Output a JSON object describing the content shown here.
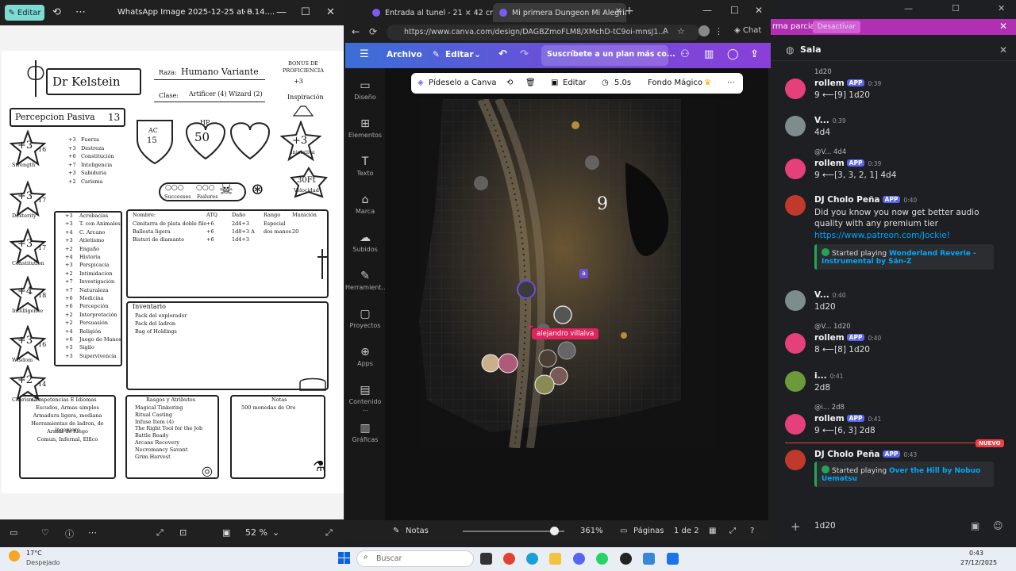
{
  "photos": {
    "edit_label": "Editar",
    "title": "WhatsApp Image 2025-12-25 at 8.14....",
    "zoom": "52 %"
  },
  "sheet": {
    "name": "Dr Kelstein",
    "raza_label": "Raza:",
    "raza": "Humano Variante",
    "clase_label": "Clase:",
    "clase": "Artificer (4) Wizard (2)",
    "bonus_label": "BONUS DE PROFICIENCIA",
    "bonus": "+3",
    "inspiracion": "Inspiración",
    "percepcion_label": "Percepcion Pasiva",
    "percepcion": "13",
    "ac_label": "AC",
    "ac": "15",
    "hp_label": "HP",
    "hp": "50",
    "iniciativa": "+3",
    "iniciativa_label": "Iniciativa",
    "velocidad": "30Ft",
    "velocidad_label": "Velocidad",
    "successes": "Successes",
    "failures": "Failures",
    "abilities": [
      {
        "mod": "+3",
        "score": "16",
        "label": "Strength"
      },
      {
        "mod": "+3",
        "score": "17",
        "label": "Dexterity"
      },
      {
        "mod": "+3",
        "score": "17",
        "label": "Constitution"
      },
      {
        "mod": "+4",
        "score": "18",
        "label": "Intelligence"
      },
      {
        "mod": "+3",
        "score": "16",
        "label": "Wisdom"
      },
      {
        "mod": "+2",
        "score": "14",
        "label": "Charisma"
      }
    ],
    "saves": [
      {
        "v": "+3",
        "n": "Fuerza"
      },
      {
        "v": "+3",
        "n": "Destreza"
      },
      {
        "v": "+6",
        "n": "Constitución"
      },
      {
        "v": "+7",
        "n": "Inteligencia"
      },
      {
        "v": "+3",
        "n": "Sabiduria"
      },
      {
        "v": "+2",
        "n": "Carisma"
      }
    ],
    "skills": [
      {
        "v": "+3",
        "n": "Acrobacias"
      },
      {
        "v": "+3",
        "n": "T. con Animales"
      },
      {
        "v": "+4",
        "n": "C. Arcano"
      },
      {
        "v": "+3",
        "n": "Atletismo"
      },
      {
        "v": "+2",
        "n": "Engaño"
      },
      {
        "v": "+4",
        "n": "Historia"
      },
      {
        "v": "+3",
        "n": "Perspicacia"
      },
      {
        "v": "+2",
        "n": "Intimidacion"
      },
      {
        "v": "+7",
        "n": "Investigación"
      },
      {
        "v": "+7",
        "n": "Naturaleza"
      },
      {
        "v": "+6",
        "n": "Medicina"
      },
      {
        "v": "+6",
        "n": "Percepción"
      },
      {
        "v": "+2",
        "n": "Interpretación"
      },
      {
        "v": "+2",
        "n": "Persuasión"
      },
      {
        "v": "+4",
        "n": "Religión"
      },
      {
        "v": "+6",
        "n": "Juego de Manos"
      },
      {
        "v": "+3",
        "n": "Sigilo"
      },
      {
        "v": "+3",
        "n": "Supervivencia"
      }
    ],
    "attack_headers": [
      "Nombre:",
      "ATQ",
      "Daño",
      "Rango",
      "Munición"
    ],
    "attacks": [
      [
        "Cimitarra de plata doble filo",
        "+6",
        "2d4+3",
        "Especial",
        ""
      ],
      [
        "Ballesta ligera",
        "+6",
        "1d8+3 A",
        "dos manos",
        "20"
      ],
      [
        "Bisturi de diamante",
        "+6",
        "1d4+3",
        "",
        ""
      ]
    ],
    "inventario_label": "Inventario",
    "inventario": [
      "Pack del explorador",
      "Pack del ladron",
      "Bag of Holdings"
    ],
    "competencias_label": "Competencias E Idiomas",
    "competencias": [
      "Escudos, Armas simples",
      "Armadura ligera, mediana",
      "Herramientas de ladron, de ingeniero",
      "Armas de fuego",
      "Comun, Infernal, Elfico"
    ],
    "rasgos_label": "Rasgos y Atributos",
    "rasgos": [
      "Magical Tinkering",
      "Ritual Casting",
      "Infuse Item (4)",
      "The Right Tool for the Job",
      "Battle Ready",
      "Arcane Recovery",
      "Necromancy Savant",
      "Grim Harvest"
    ],
    "notas_label": "Notas",
    "notas": [
      "500 monedas de Oro"
    ]
  },
  "browser": {
    "tab1": "Entrada al tunel - 21 × 42 cm",
    "tab2": "Mi primera Dungeon Mi Alegria - ...",
    "url": "https://www.canva.com/design/DAGBZmoFLM8/XMchD-tC9oi-mnsJ1...",
    "chat": "Chat"
  },
  "canva": {
    "archivo": "Archivo",
    "editar": "Editar",
    "promo": "Suscríbete a un plan más co...",
    "rail": [
      "Diseño",
      "Elementos",
      "Texto",
      "Marca",
      "Subidos",
      "Herramient...",
      "Proyectos",
      "Apps",
      "Contenido ...",
      "Gráficas"
    ],
    "toolbar": {
      "pideselo": "Pídeselo a Canva",
      "editar": "Editar",
      "duration": "5.0s",
      "fondo": "Fondo Mágico"
    },
    "map_number": "9",
    "cursor_user": "alejandro villalva",
    "token_tag": "a",
    "notas": "Notas",
    "zoom": "361%",
    "paginas": "Páginas",
    "page_count": "1 de 2"
  },
  "discord": {
    "banner": "rma parcial.",
    "desactivar": "Desactivar",
    "channel": "Sala",
    "new_label": "NUEVO",
    "input": "1d20",
    "messages": [
      {
        "reply": "1d20",
        "name": "rollem",
        "app": "APP",
        "time": "0:39",
        "text": "9  ⟵[9] 1d20"
      },
      {
        "name": "V...",
        "time": "0:39",
        "text": "4d4"
      },
      {
        "reply": "@V...  4d4",
        "name": "rollem",
        "app": "APP",
        "time": "0:39",
        "text": "9  ⟵[3, 3, 2, 1] 4d4"
      },
      {
        "name": "DJ Cholo Peña",
        "app": "APP",
        "time": "0:40",
        "text": "Did you know you now get better audio quality with any premium tier",
        "link": "https://www.patreon.com/Jockie!",
        "embed_prefix": "Started playing ",
        "embed_title": "Wonderland Reverie - Instrumental by Sän-Z"
      },
      {
        "name": "V...",
        "time": "0:40",
        "text": "1d20"
      },
      {
        "reply": "@V...  1d20",
        "name": "rollem",
        "app": "APP",
        "time": "0:40",
        "text": "8  ⟵[8] 1d20"
      },
      {
        "name": "i...",
        "time": "0:41",
        "text": "2d8"
      },
      {
        "reply": "@i...  2d8",
        "name": "rollem",
        "app": "APP",
        "time": "0:41",
        "text": "9  ⟵[6, 3] 2d8"
      },
      {
        "name": "DJ Cholo Peña",
        "app": "APP",
        "time": "0:43",
        "embed_prefix": "Started playing ",
        "embed_title": "Over the Hill by Nobuo Uematsu"
      }
    ]
  },
  "taskbar": {
    "temp": "17°C",
    "weather": "Despejado",
    "search": "Buscar",
    "time": "0:43",
    "date": "27/12/2025"
  }
}
